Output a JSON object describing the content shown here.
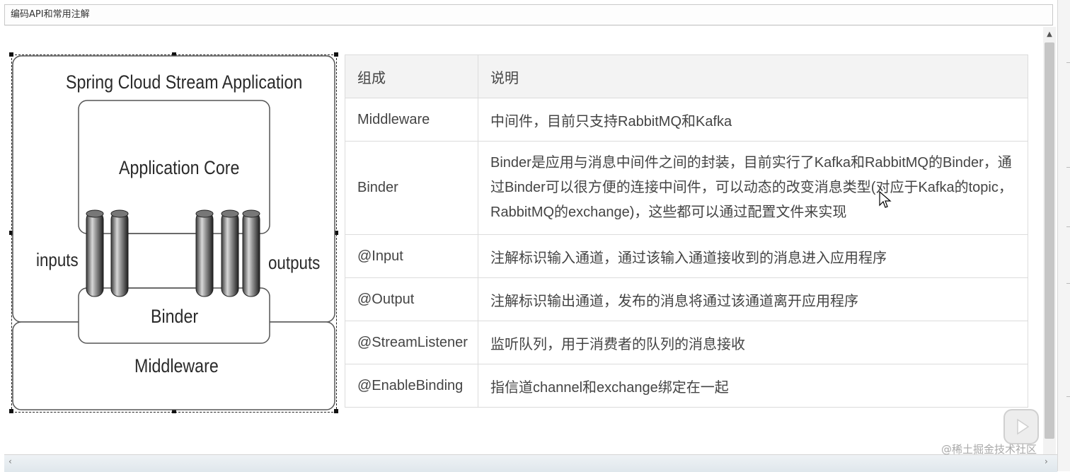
{
  "window": {
    "title": "编码API和常用注解"
  },
  "diagram": {
    "title": "Spring Cloud Stream Application",
    "core": "Application Core",
    "binder": "Binder",
    "middleware": "Middleware",
    "inputs": "inputs",
    "outputs": "outputs"
  },
  "table": {
    "headers": [
      "组成",
      "说明"
    ],
    "rows": [
      {
        "name": "Middleware",
        "desc": "中间件，目前只支持RabbitMQ和Kafka"
      },
      {
        "name": "Binder",
        "desc": "Binder是应用与消息中间件之间的封装，目前实行了Kafka和RabbitMQ的Binder，通过Binder可以很方便的连接中间件，可以动态的改变消息类型(对应于Kafka的topic，RabbitMQ的exchange)，这些都可以通过配置文件来实现"
      },
      {
        "name": "@Input",
        "desc": "注解标识输入通道，通过该输入通道接收到的消息进入应用程序"
      },
      {
        "name": "@Output",
        "desc": "注解标识输出通道，发布的消息将通过该通道离开应用程序"
      },
      {
        "name": "@StreamListener",
        "desc": "监听队列，用于消费者的队列的消息接收"
      },
      {
        "name": "@EnableBinding",
        "desc": "指信道channel和exchange绑定在一起"
      }
    ]
  },
  "watermark": "@稀土掘金技术社区",
  "icons": {
    "scroll_up": "chevron-up-icon",
    "scroll_left": "chevron-left-icon",
    "scroll_right": "chevron-right-icon",
    "cursor": "mouse-cursor-icon",
    "player": "play-icon"
  }
}
